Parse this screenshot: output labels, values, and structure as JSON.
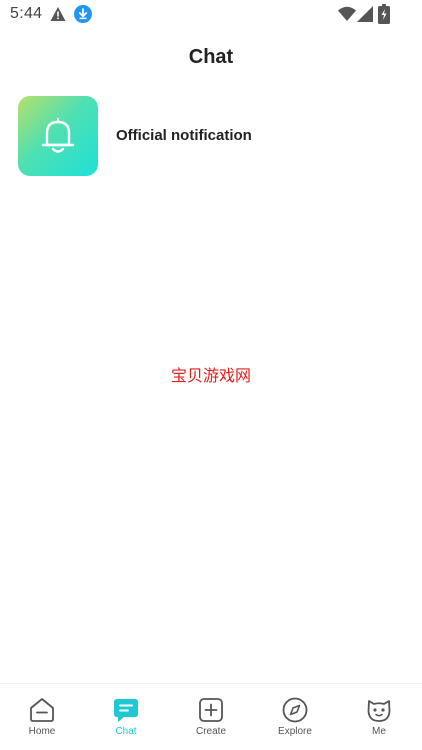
{
  "status_bar": {
    "time": "5:44",
    "icons": [
      "warning-icon",
      "download-icon",
      "wifi-icon",
      "signal-icon",
      "battery-icon"
    ]
  },
  "header": {
    "title": "Chat"
  },
  "chats": [
    {
      "name": "Official notification",
      "icon": "bell-icon"
    }
  ],
  "watermark": "宝贝游戏网",
  "bottom_nav": {
    "active": "Chat",
    "accent_color": "#1ec9d4",
    "items": [
      {
        "label": "Home",
        "icon": "home-icon"
      },
      {
        "label": "Chat",
        "icon": "chat-icon"
      },
      {
        "label": "Create",
        "icon": "create-icon"
      },
      {
        "label": "Explore",
        "icon": "compass-icon"
      },
      {
        "label": "Me",
        "icon": "cat-face-icon"
      }
    ]
  }
}
